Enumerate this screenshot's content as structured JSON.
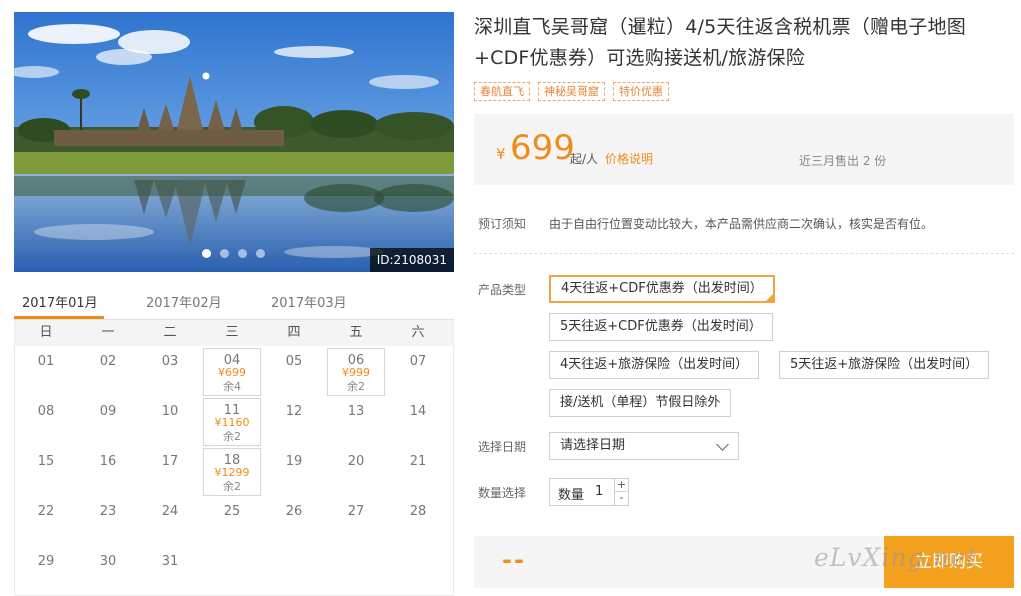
{
  "photo": {
    "id_badge": "ID:2108031",
    "slide_count": 4,
    "active_slide": 1
  },
  "calendar": {
    "months": [
      "2017年01月",
      "2017年02月",
      "2017年03月"
    ],
    "weekdays": [
      "日",
      "一",
      "二",
      "三",
      "四",
      "五",
      "六"
    ],
    "rows": [
      [
        {
          "d": "01"
        },
        {
          "d": "02"
        },
        {
          "d": "03"
        },
        {
          "d": "04",
          "p": "¥699",
          "r": "余4"
        },
        {
          "d": "05"
        },
        {
          "d": "06",
          "p": "¥999",
          "r": "余2"
        },
        {
          "d": "07"
        }
      ],
      [
        {
          "d": "08"
        },
        {
          "d": "09"
        },
        {
          "d": "10"
        },
        {
          "d": "11",
          "p": "¥1160",
          "r": "余2"
        },
        {
          "d": "12"
        },
        {
          "d": "13"
        },
        {
          "d": "14"
        }
      ],
      [
        {
          "d": "15"
        },
        {
          "d": "16"
        },
        {
          "d": "17"
        },
        {
          "d": "18",
          "p": "¥1299",
          "r": "余2"
        },
        {
          "d": "19"
        },
        {
          "d": "20"
        },
        {
          "d": "21"
        }
      ],
      [
        {
          "d": "22"
        },
        {
          "d": "23"
        },
        {
          "d": "24"
        },
        {
          "d": "25"
        },
        {
          "d": "26"
        },
        {
          "d": "27"
        },
        {
          "d": "28"
        }
      ],
      [
        {
          "d": "29"
        },
        {
          "d": "30"
        },
        {
          "d": "31"
        }
      ]
    ]
  },
  "product": {
    "title": "深圳直飞吴哥窟（暹粒）4/5天往返含税机票（赠电子地图+CDF优惠券）可选购接送机/旅游保险",
    "tags": [
      "春航直飞",
      "神秘吴哥窟",
      "特价优惠"
    ]
  },
  "price": {
    "currency": "¥",
    "amount": "699",
    "unit": "起/人",
    "link": "价格说明",
    "sold": "近三月售出 2 份"
  },
  "notice": {
    "label": "预订须知",
    "text": "由于自由行位置变动比较大，本产品需供应商二次确认，核实是否有位。"
  },
  "options": {
    "label": "产品类型",
    "items": [
      "4天往返+CDF优惠券（出发时间）",
      "5天往返+CDF优惠券（出发时间）",
      "4天往返+旅游保险（出发时间）",
      "5天往返+旅游保险（出发时间）",
      "接/送机（单程）节假日除外"
    ],
    "selected_index": 0
  },
  "date_select": {
    "label": "选择日期",
    "value": "请选择日期"
  },
  "quantity": {
    "label": "数量选择",
    "inner_label": "数量",
    "value": "1",
    "plus": "+",
    "minus": "-"
  },
  "footer": {
    "total": "--",
    "buy_label": "立即购买",
    "watermark": "eLvXing.net"
  },
  "colors": {
    "accent": "#f08c1a",
    "buy_button": "#f3a11f",
    "panel_bg": "#f5f5f5"
  }
}
